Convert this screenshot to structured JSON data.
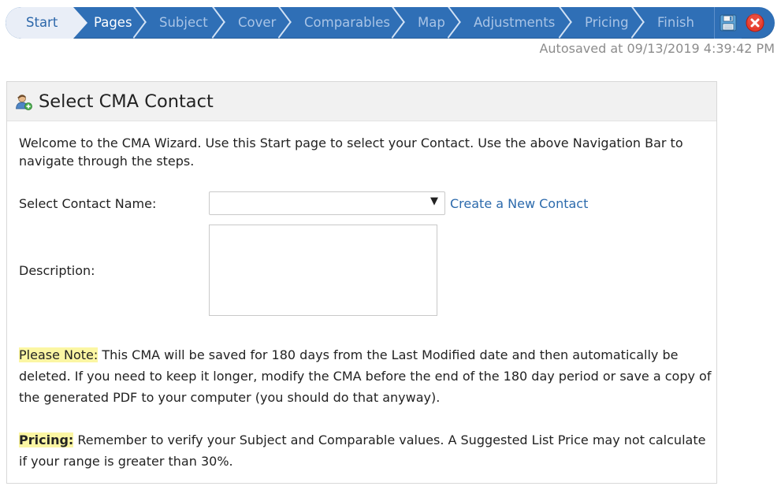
{
  "wizard": {
    "steps": [
      {
        "label": "Start"
      },
      {
        "label": "Pages"
      },
      {
        "label": "Subject"
      },
      {
        "label": "Cover"
      },
      {
        "label": "Comparables"
      },
      {
        "label": "Map"
      },
      {
        "label": "Adjustments"
      },
      {
        "label": "Pricing"
      },
      {
        "label": "Finish"
      }
    ],
    "current_step": "Pages",
    "save_icon": "floppy-disk-icon",
    "close_icon": "red-x-circle-icon"
  },
  "autosave": {
    "text": "Autosaved at 09/13/2019 4:39:42 PM"
  },
  "panel": {
    "icon": "user-add-icon",
    "title": "Select CMA Contact",
    "intro": "Welcome to the CMA Wizard. Use this Start page to select your Contact. Use the above Navigation Bar to navigate through the steps.",
    "contact_label": "Select Contact Name:",
    "contact_value": "",
    "create_contact_link": "Create a New Contact",
    "description_label": "Description:",
    "description_value": "",
    "note_label": "Please Note:",
    "note_text": " This CMA will be saved for 180 days from the Last Modified date and then automatically be deleted. If you need to keep it longer, modify the CMA before the end of the 180 day period or save a copy of the generated PDF to your computer (you should do that anyway).",
    "pricing_label": "Pricing:",
    "pricing_text": " Remember to verify your Subject and Comparable values. A Suggested List Price may not calculate if your range is greater than 30%."
  },
  "colors": {
    "nav_blue": "#2f6fb6",
    "nav_inactive_text": "#a9c4e6",
    "link_blue": "#2c6aac",
    "highlight_yellow": "#fbf6a3"
  }
}
